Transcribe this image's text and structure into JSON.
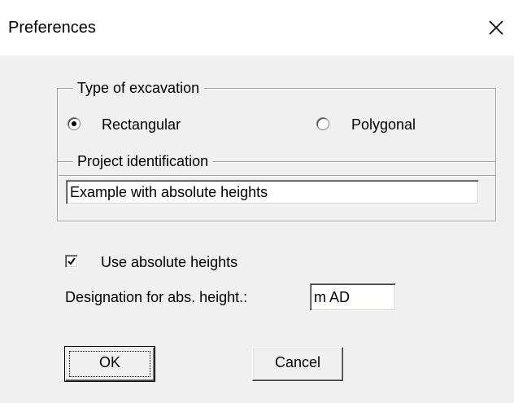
{
  "window": {
    "title": "Preferences"
  },
  "excavation_group": {
    "legend": "Type of excavation",
    "options": [
      {
        "label": "Rectangular",
        "selected": true
      },
      {
        "label": "Polygonal",
        "selected": false
      }
    ]
  },
  "project_group": {
    "legend": "Project identification",
    "value": "Example with absolute heights"
  },
  "absolute_heights": {
    "label": "Use absolute heights",
    "checked": true
  },
  "designation": {
    "label": "Designation for abs. height.:",
    "value": "m AD"
  },
  "buttons": {
    "ok_label": "OK",
    "cancel_label": "Cancel"
  },
  "icons": {
    "close": "close-icon",
    "check": "check-icon"
  }
}
